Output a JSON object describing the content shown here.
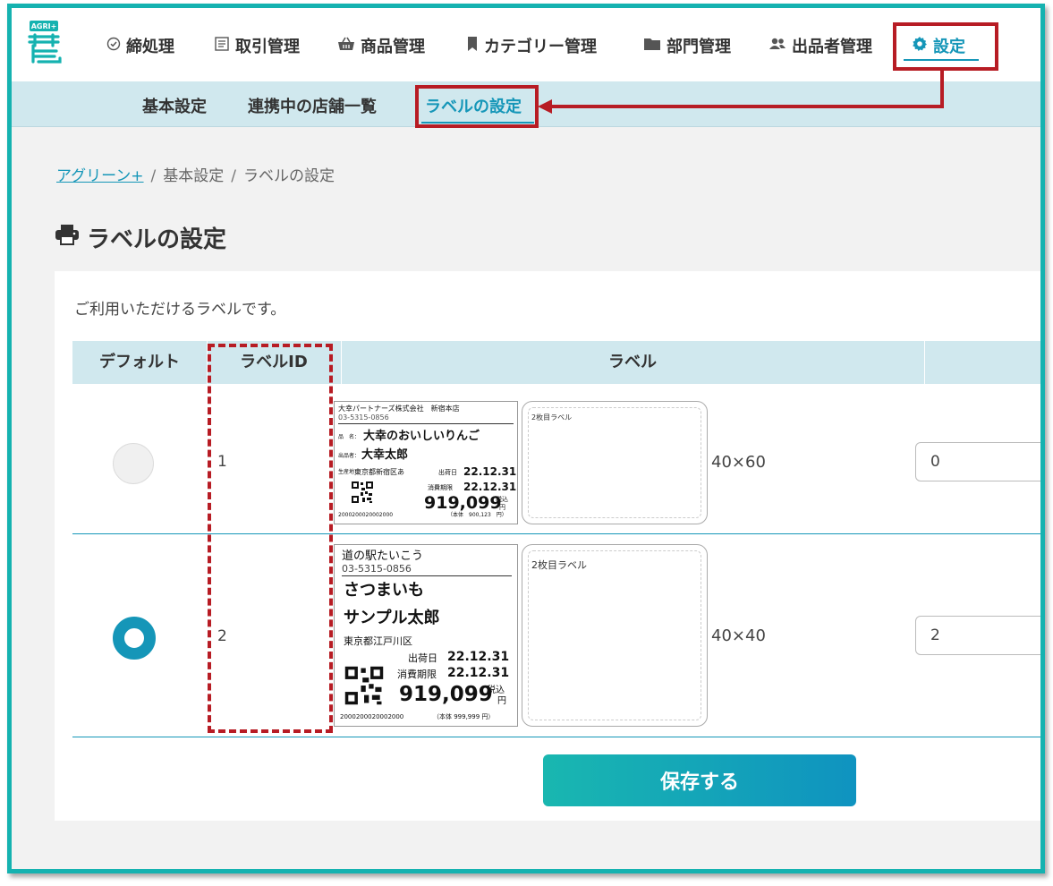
{
  "nav": {
    "items": [
      {
        "label": "締処理",
        "icon": "check-circle-icon"
      },
      {
        "label": "取引管理",
        "icon": "receipt-icon"
      },
      {
        "label": "商品管理",
        "icon": "basket-icon"
      },
      {
        "label": "カテゴリー管理",
        "icon": "bookmark-icon"
      },
      {
        "label": "部門管理",
        "icon": "folder-icon"
      },
      {
        "label": "出品者管理",
        "icon": "users-icon"
      },
      {
        "label": "設定",
        "icon": "gear-icon",
        "active": true
      }
    ],
    "logo_text": "AGRI+"
  },
  "subnav": {
    "items": [
      {
        "label": "基本設定"
      },
      {
        "label": "連携中の店舗一覧"
      },
      {
        "label": "ラベルの設定",
        "active": true
      }
    ]
  },
  "breadcrumb": {
    "root": "アグリーン+",
    "mid": "基本設定",
    "current": "ラベルの設定",
    "separator": "/"
  },
  "page": {
    "title": "ラベルの設定",
    "title_icon": "printer-icon",
    "description": "ご利用いただけるラベルです。"
  },
  "table": {
    "headers": [
      "デフォルト",
      "ラベルID",
      "ラベル"
    ],
    "rows": [
      {
        "default_selected": false,
        "label_id": "1",
        "size": "40×60",
        "quantity": "0",
        "preview": {
          "shop": "大幸パートナーズ株式会社　新宿本店",
          "phone": "03-5315-0856",
          "product_prefix": "品　名：",
          "product": "大幸のおいしいりんご",
          "producer_prefix": "出品者：",
          "producer": "大幸太郎",
          "origin_prefix": "生産地：",
          "origin": "東京都新宿区あ",
          "ship_label": "出荷日",
          "ship_date": "22.12.31",
          "expiry_label": "消費期限",
          "expiry_date": "22.12.31",
          "price": "919,099",
          "tax_label": "税込",
          "yen": "円",
          "base_price": "（本体　900,123　円）",
          "barcode": "2000200020002000",
          "second_label": "2枚目ラベル"
        }
      },
      {
        "default_selected": true,
        "label_id": "2",
        "size": "40×40",
        "quantity": "2",
        "preview": {
          "shop": "道の駅たいこう",
          "phone": "03-5315-0856",
          "product": "さつまいも",
          "producer": "サンプル太郎",
          "origin": "東京都江戸川区",
          "ship_label": "出荷日",
          "ship_date": "22.12.31",
          "expiry_label": "消費期限",
          "expiry_date": "22.12.31",
          "price": "919,099",
          "tax_label": "税込",
          "yen": "円",
          "base_price": "（本体 999,999 円）",
          "barcode": "2000200020002000",
          "second_label": "2枚目ラベル"
        }
      }
    ]
  },
  "actions": {
    "save_label": "保存する"
  },
  "colors": {
    "accent": "#1596b8",
    "frame": "#15b2b0",
    "highlight": "#b71c24",
    "subnav_bg": "#d0e8ee"
  }
}
